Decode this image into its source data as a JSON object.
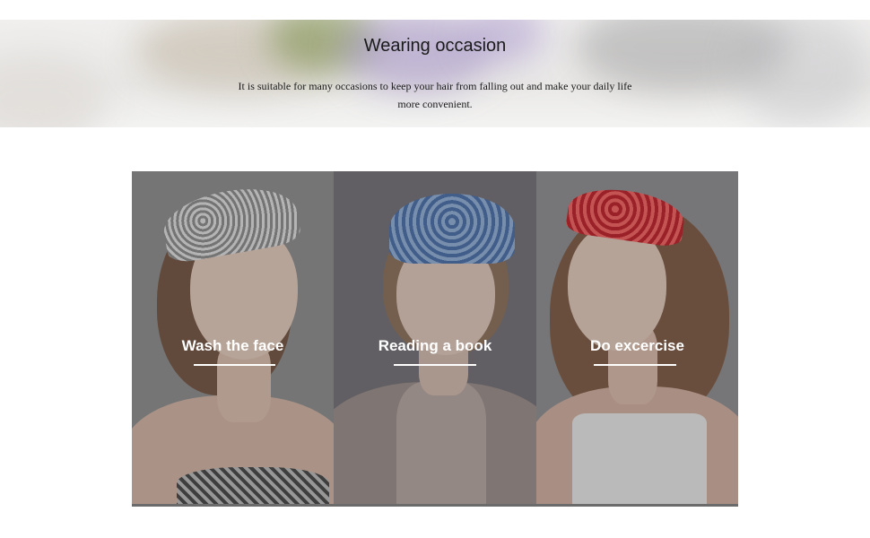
{
  "banner": {
    "title": "Wearing occasion",
    "description": "It is suitable for many occasions to keep your hair from falling out and make your daily life more convenient."
  },
  "occasions": [
    {
      "label": "Wash the face",
      "headband": "gray paisley headband"
    },
    {
      "label": "Reading a book",
      "headband": "blue paisley headband"
    },
    {
      "label": "Do excercise",
      "headband": "red paisley headband"
    }
  ],
  "colors": {
    "text": "#1a1a1a",
    "card_label": "#ffffff",
    "overlay": "#464648"
  }
}
